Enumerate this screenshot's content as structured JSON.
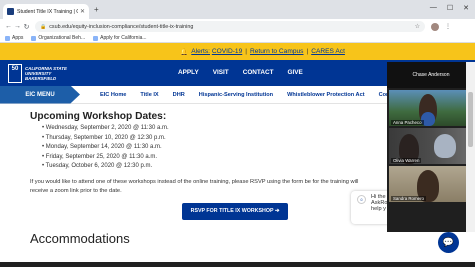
{
  "browser": {
    "tab_title": "Student Title IX Training | Califo...",
    "url": "csub.edu/equity-inclusion-compliance/student-title-ix-training",
    "bookmarks": [
      "Apps",
      "Organizational Beh...",
      "Apply for California..."
    ]
  },
  "alert": {
    "label": "Alerts:",
    "links": [
      "COVID-19",
      "Return to Campus",
      "CARES Act"
    ],
    "separator": "|"
  },
  "header": {
    "logo_mark": "50",
    "logo_line1": "CALIFORNIA STATE",
    "logo_line2": "UNIVERSITY",
    "logo_line3": "BAKERSFIELD",
    "nav": [
      "APPLY",
      "VISIT",
      "CONTACT",
      "GIVE"
    ]
  },
  "subnav": {
    "menu_label": "EIC MENU",
    "items": [
      "EIC Home",
      "Title IX",
      "DHR",
      "Hispanic-Serving Institution",
      "Whistleblower Protection Act",
      "Conf"
    ]
  },
  "content": {
    "heading": "Upcoming Workshop Dates:",
    "dates": [
      "Wednesday, September 2, 2020 @ 11:30 a.m.",
      "Thursday, September 10, 2020 @ 12:30 p.m.",
      "Monday, September 14, 2020 @ 11:30 a.m.",
      "Friday, September 25, 2020 @ 11:30 a.m.",
      "Tuesday, October 6, 2020 @ 12:30 p.m."
    ],
    "paragraph": "If you would like to attend one of these workshops instead of the online training, please RSVP using the form be for the training will receive a zoom link prior to the date.",
    "rsvp_button": "RSVP FOR TITLE IX WORKSHOP",
    "next_heading": "Accommodations"
  },
  "chat": {
    "line1": "Hi the",
    "line2": "AskRo",
    "line3": "help y"
  },
  "zoom": {
    "header_name": "Chase Anderson",
    "participants": [
      "Anna Pacheco",
      "Olivia Warren",
      "Sandra Romero"
    ]
  },
  "colors": {
    "brand_blue": "#003594",
    "gold": "#f7c41a",
    "menu_blue": "#1d5ea8"
  }
}
